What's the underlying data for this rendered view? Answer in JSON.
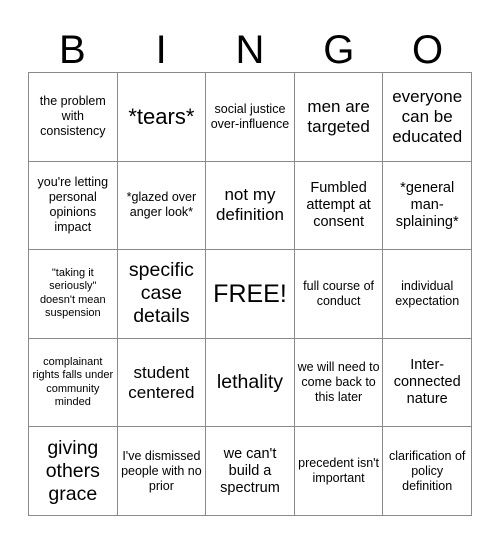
{
  "card": {
    "header_letters": [
      "B",
      "I",
      "N",
      "G",
      "O"
    ],
    "grid_size": 5,
    "free_space_index": 12,
    "colors": {
      "background": "#ffffff",
      "text": "#000000",
      "border": "#8a8a8a"
    },
    "cells": [
      {
        "text": "the problem with consistency",
        "size": "t-sm"
      },
      {
        "text": "*tears*",
        "size": "t-xxl"
      },
      {
        "text": "social justice over-influence",
        "size": "t-sm"
      },
      {
        "text": "men are targeted",
        "size": "t-lg"
      },
      {
        "text": "everyone can be educated",
        "size": "t-lg"
      },
      {
        "text": "you're letting personal opinions impact",
        "size": "t-sm"
      },
      {
        "text": "*glazed over anger look*",
        "size": "t-sm"
      },
      {
        "text": "not my definition",
        "size": "t-lg"
      },
      {
        "text": "Fumbled attempt at consent",
        "size": "t-md"
      },
      {
        "text": "*general man-splaining*",
        "size": "t-md"
      },
      {
        "text": "\"taking it seriously\" doesn't mean suspension",
        "size": "t-xs"
      },
      {
        "text": "specific case details",
        "size": "t-xl"
      },
      {
        "text": "FREE!",
        "size": "t-free"
      },
      {
        "text": "full course of conduct",
        "size": "t-sm"
      },
      {
        "text": "individual expectation",
        "size": "t-sm"
      },
      {
        "text": "complainant rights falls under community minded",
        "size": "t-xs"
      },
      {
        "text": "student centered",
        "size": "t-lg"
      },
      {
        "text": "lethality",
        "size": "t-xl"
      },
      {
        "text": "we will need to come back to this later",
        "size": "t-sm"
      },
      {
        "text": "Inter-connected nature",
        "size": "t-md"
      },
      {
        "text": "giving others grace",
        "size": "t-xl"
      },
      {
        "text": "I've dismissed people with no prior",
        "size": "t-sm"
      },
      {
        "text": "we can't build a spectrum",
        "size": "t-md"
      },
      {
        "text": "precedent isn't important",
        "size": "t-sm"
      },
      {
        "text": "clarification of policy definition",
        "size": "t-sm"
      }
    ]
  }
}
